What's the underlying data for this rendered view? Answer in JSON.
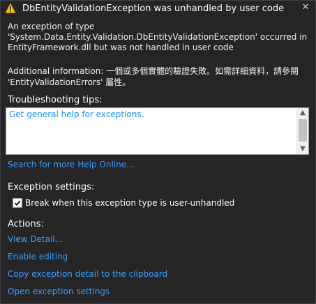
{
  "header": {
    "title": "DbEntityValidationException was unhandled by user code",
    "close_glyph": "✕"
  },
  "message": {
    "line1": "An exception of type",
    "line2": "'System.Data.Entity.Validation.DbEntityValidationException' occurred in",
    "line3": "EntityFramework.dll but was not handled in user code"
  },
  "additional": {
    "line1": "Additional information: 一個或多個實體的驗證失敗。如需詳細資料，請參閱",
    "line2": "'EntityValidationErrors' 屬性。"
  },
  "troubleshooting": {
    "title": "Troubleshooting tips:",
    "items": [
      "Get general help for exceptions."
    ]
  },
  "search_link": "Search for more Help Online...",
  "exception_settings": {
    "title": "Exception settings:",
    "checkbox_label": "Break when this exception type is user-unhandled",
    "checked": true
  },
  "actions": {
    "title": "Actions:",
    "items": [
      "View Detail...",
      "Enable editing",
      "Copy exception detail to the clipboard",
      "Open exception settings"
    ]
  },
  "colors": {
    "background": "#252526",
    "link": "#3aa0ff",
    "warning": "#f5c518"
  },
  "icons": {
    "header": "warning-icon",
    "close": "close-icon",
    "checkbox": "checkmark-icon"
  }
}
